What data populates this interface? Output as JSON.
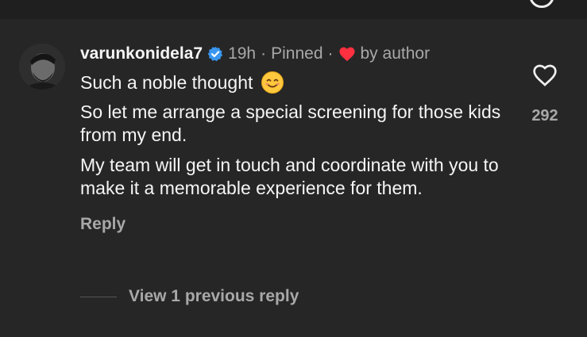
{
  "comment": {
    "username": "varunkonidela7",
    "time": "19h",
    "separator": "·",
    "pinned": "Pinned",
    "liked_by": "by author",
    "lines": [
      "Such a noble thought",
      "So let me arrange a special screening for those kids from my end.",
      "My team will get in touch and coordinate with you to make it a memorable experience for them."
    ],
    "emoji": "smiling-face-emoji",
    "reply_label": "Reply",
    "like_count": "292"
  },
  "replies": {
    "view_label": "View 1 previous reply"
  },
  "colors": {
    "background": "#262626",
    "primary_text": "#f5f5f5",
    "secondary_text": "#a8a8a8",
    "verified_blue": "#3897f0",
    "author_heart": "#ff3040"
  }
}
